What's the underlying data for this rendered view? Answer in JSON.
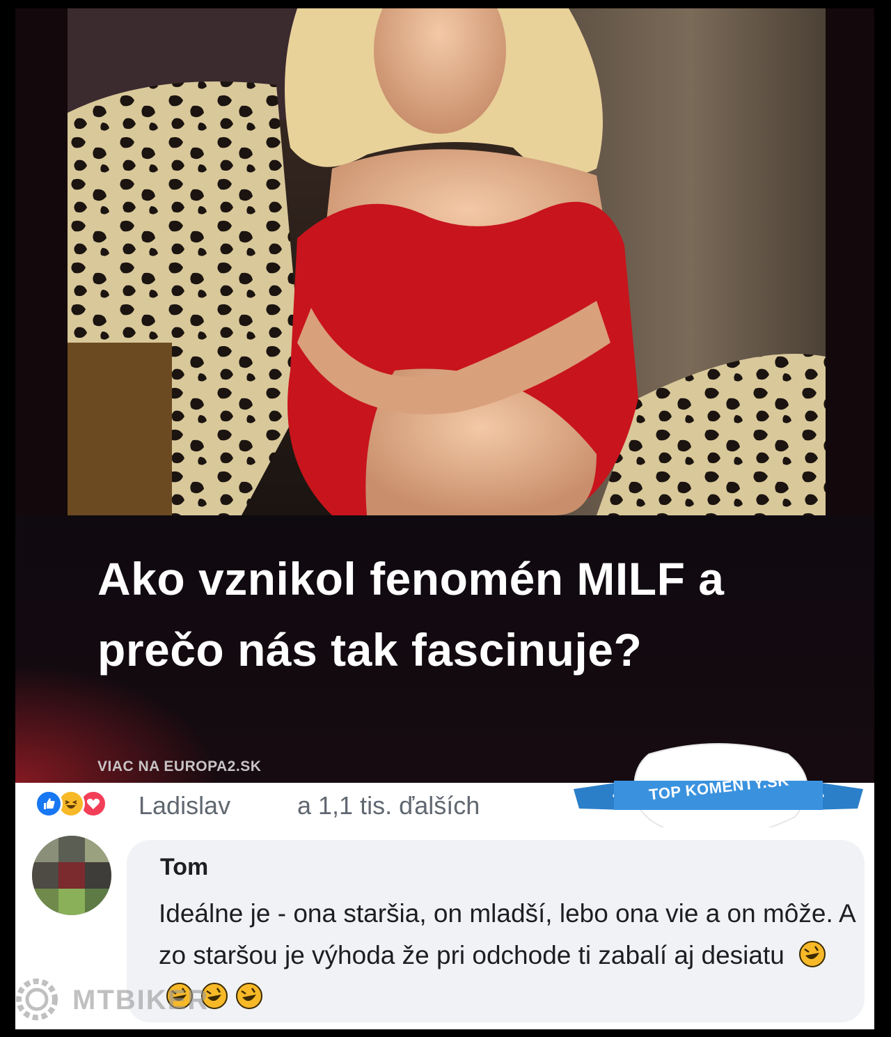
{
  "post": {
    "headline": "Ako vznikol fenomén MILF a prečo nás tak fascinuje?",
    "source": "VIAC NA EUROPA2.SK",
    "image_alt": "woman in red dress on leopard-print armchair"
  },
  "reactions": {
    "icons": [
      "like-icon",
      "haha-icon",
      "love-icon"
    ],
    "name": "Ladislav",
    "others": "a 1,1 tis. ďalších"
  },
  "badge": {
    "text": "TOP KOMENTY.SK"
  },
  "comment": {
    "author": "Tom",
    "text": "Ideálne je - ona staršia, on mladší, lebo ona vie a on môže. A zo staršou je výhoda že pri odchode ti zabalí aj desiatu",
    "emoji_count": 4,
    "emoji_name": "rolling-on-floor-laughing-emoji"
  },
  "watermark": {
    "text": "MTBIKER"
  },
  "colors": {
    "like_blue": "#1877f2",
    "haha_yellow": "#f7b928",
    "love_red": "#f33e58",
    "badge_blue": "#2b7fc9",
    "dress_red": "#c8141c"
  }
}
